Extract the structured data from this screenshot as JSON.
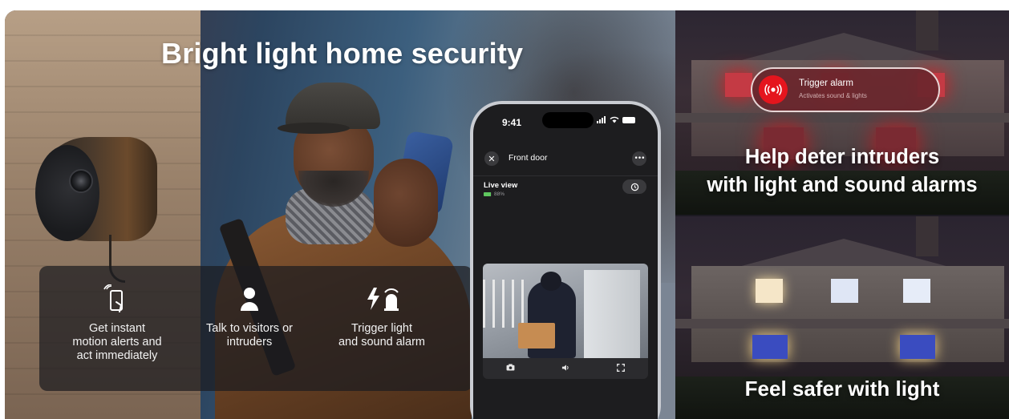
{
  "hero": {
    "title": "Bright light home security"
  },
  "features": [
    {
      "icon": "phone-motion-icon",
      "label": "Get instant\nmotion alerts and\nact immediately"
    },
    {
      "icon": "person-icon",
      "label": "Talk to visitors or\nintruders"
    },
    {
      "icon": "light-siren-icon",
      "label": "Trigger light\nand sound alarm"
    }
  ],
  "phone": {
    "status_time": "9:41",
    "header_title": "Front door",
    "close_icon": "close-icon",
    "more_icon": "more-icon",
    "live_view_label": "Live view",
    "battery_percent": "88%",
    "battery_level": 0.88,
    "battery_color": "#5fc85f",
    "history_icon": "history-icon",
    "controls": [
      "camera-icon",
      "speaker-icon",
      "fullscreen-icon"
    ]
  },
  "alarm": {
    "title": "Trigger alarm",
    "subtitle": "Activates sound & lights",
    "accent": "#e5151d",
    "icon": "alarm-icon"
  },
  "panels": {
    "top_caption": "Help deter intruders\nwith light and sound alarms",
    "bottom_caption": "Feel safer with light"
  }
}
